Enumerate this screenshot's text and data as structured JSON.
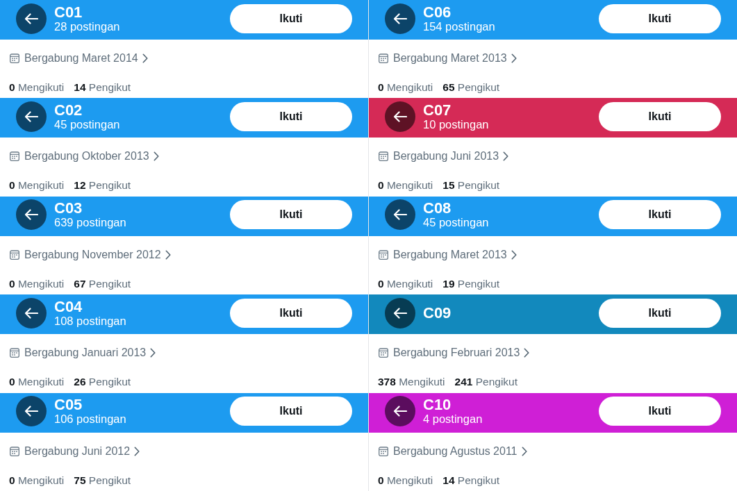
{
  "columns": [
    {
      "profiles": [
        {
          "name": "C01",
          "posts": "28 postingan",
          "color": "#1d9bf0",
          "follow_button": "Ikuti",
          "joined": "Bergabung Maret 2014",
          "following": "**0** Mengikuti",
          "followers": "**14** Pengikut"
        },
        {
          "name": "C02",
          "posts": "45 postingan",
          "color": "#1d9bf0",
          "follow_button": "Ikuti",
          "joined": "Bergabung Oktober 2013",
          "following": "**0** Mengikuti",
          "followers": "**12** Pengikut"
        },
        {
          "name": "C03",
          "posts": "639 postingan",
          "color": "#1d9bf0",
          "follow_button": "Ikuti",
          "joined": "Bergabung November 2012",
          "following": "**0** Mengikuti",
          "followers": "**67** Pengikut"
        },
        {
          "name": "C04",
          "posts": "108 postingan",
          "color": "#1d9bf0",
          "follow_button": "Ikuti",
          "joined": "Bergabung Januari 2013",
          "following": "**0** Mengikuti",
          "followers": "**26** Pengikut"
        },
        {
          "name": "C05",
          "posts": "106 postingan",
          "color": "#1d9bf0",
          "follow_button": "Ikuti",
          "joined": "Bergabung Juni 2012",
          "following": "**0** Mengikuti",
          "followers": "**75** Pengikut"
        }
      ]
    },
    {
      "profiles": [
        {
          "name": "C06",
          "posts": "154 postingan",
          "color": "#1d9bf0",
          "follow_button": "Ikuti",
          "joined": "Bergabung Maret 2013",
          "following": "**0** Mengikuti",
          "followers": "**65** Pengikut"
        },
        {
          "name": "C07",
          "posts": "10 postingan",
          "color": "#d52a56",
          "follow_button": "Ikuti",
          "joined": "Bergabung Juni 2013",
          "following": "**0** Mengikuti",
          "followers": "**15** Pengikut"
        },
        {
          "name": "C08",
          "posts": "45 postingan",
          "color": "#1d9bf0",
          "follow_button": "Ikuti",
          "joined": "Bergabung Maret 2013",
          "following": "**0** Mengikuti",
          "followers": "**19** Pengikut"
        },
        {
          "name": "C09",
          "color": "#1289bd",
          "follow_button": "Ikuti",
          "joined": "Bergabung Februari 2013",
          "following": "**378** Mengikuti",
          "followers": "**241** Pengikut"
        },
        {
          "name": "C10",
          "posts": "4 postingan",
          "color": "#cf1fd6",
          "follow_button": "Ikuti",
          "joined": "Bergabung Agustus 2011",
          "following": "**0** Mengikuti",
          "followers": "**14** Pengikut"
        }
      ]
    }
  ]
}
